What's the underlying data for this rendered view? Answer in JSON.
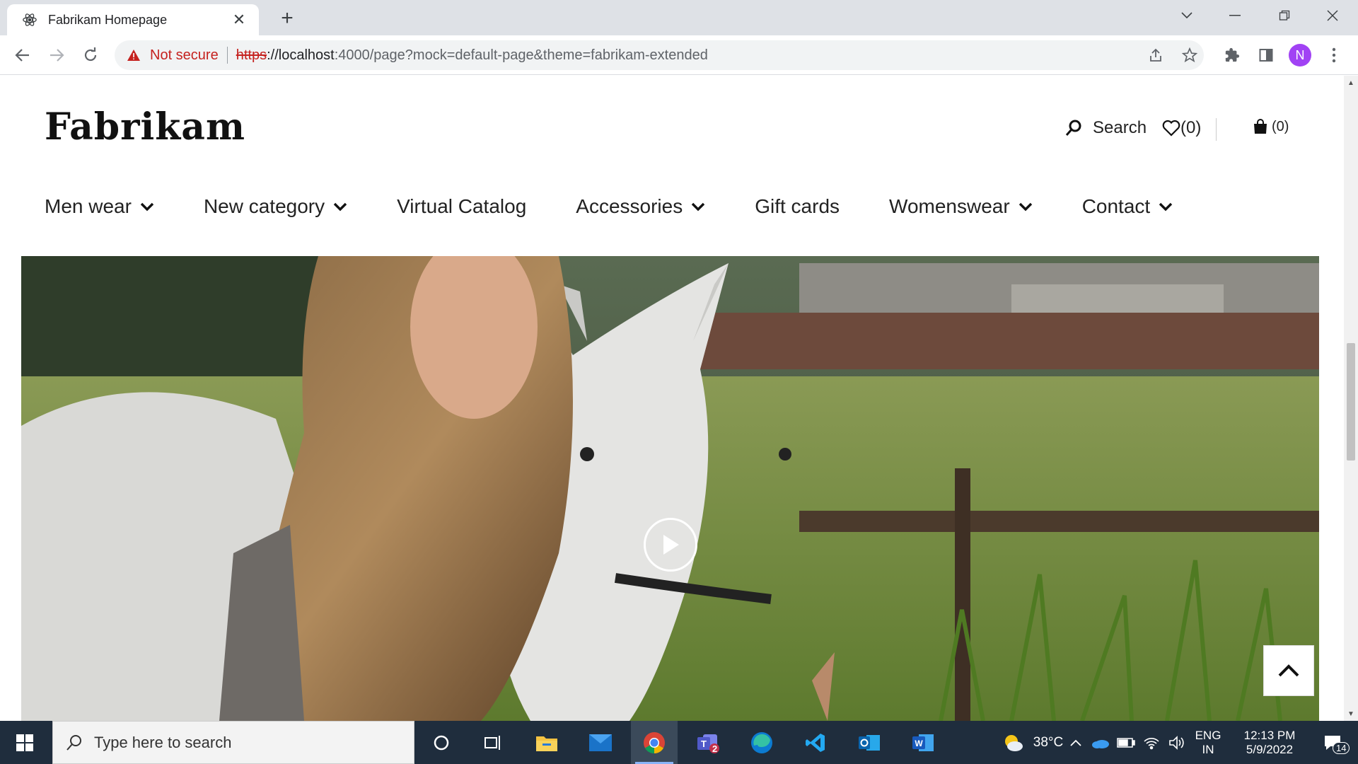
{
  "browser": {
    "tab_title": "Fabrikam Homepage",
    "security_label": "Not secure",
    "url_scheme": "https",
    "url_host": "://localhost",
    "url_rest": ":4000/page?mock=default-page&theme=fabrikam-extended",
    "profile_initial": "N"
  },
  "site": {
    "logo": "Fabrikam",
    "search_label": "Search",
    "wishlist_count": "(0)",
    "cart_count": "(0)",
    "nav": [
      {
        "label": "Men wear",
        "has_dropdown": true
      },
      {
        "label": "New category",
        "has_dropdown": true
      },
      {
        "label": "Virtual Catalog",
        "has_dropdown": false
      },
      {
        "label": "Accessories",
        "has_dropdown": true
      },
      {
        "label": "Gift cards",
        "has_dropdown": false
      },
      {
        "label": "Womenswear",
        "has_dropdown": true
      },
      {
        "label": "Contact",
        "has_dropdown": true
      }
    ]
  },
  "taskbar": {
    "search_placeholder": "Type here to search",
    "weather": "38°C",
    "lang_top": "ENG",
    "lang_bottom": "IN",
    "time": "12:13 PM",
    "date": "5/9/2022",
    "notification_count": "14",
    "teams_badge": "2"
  }
}
